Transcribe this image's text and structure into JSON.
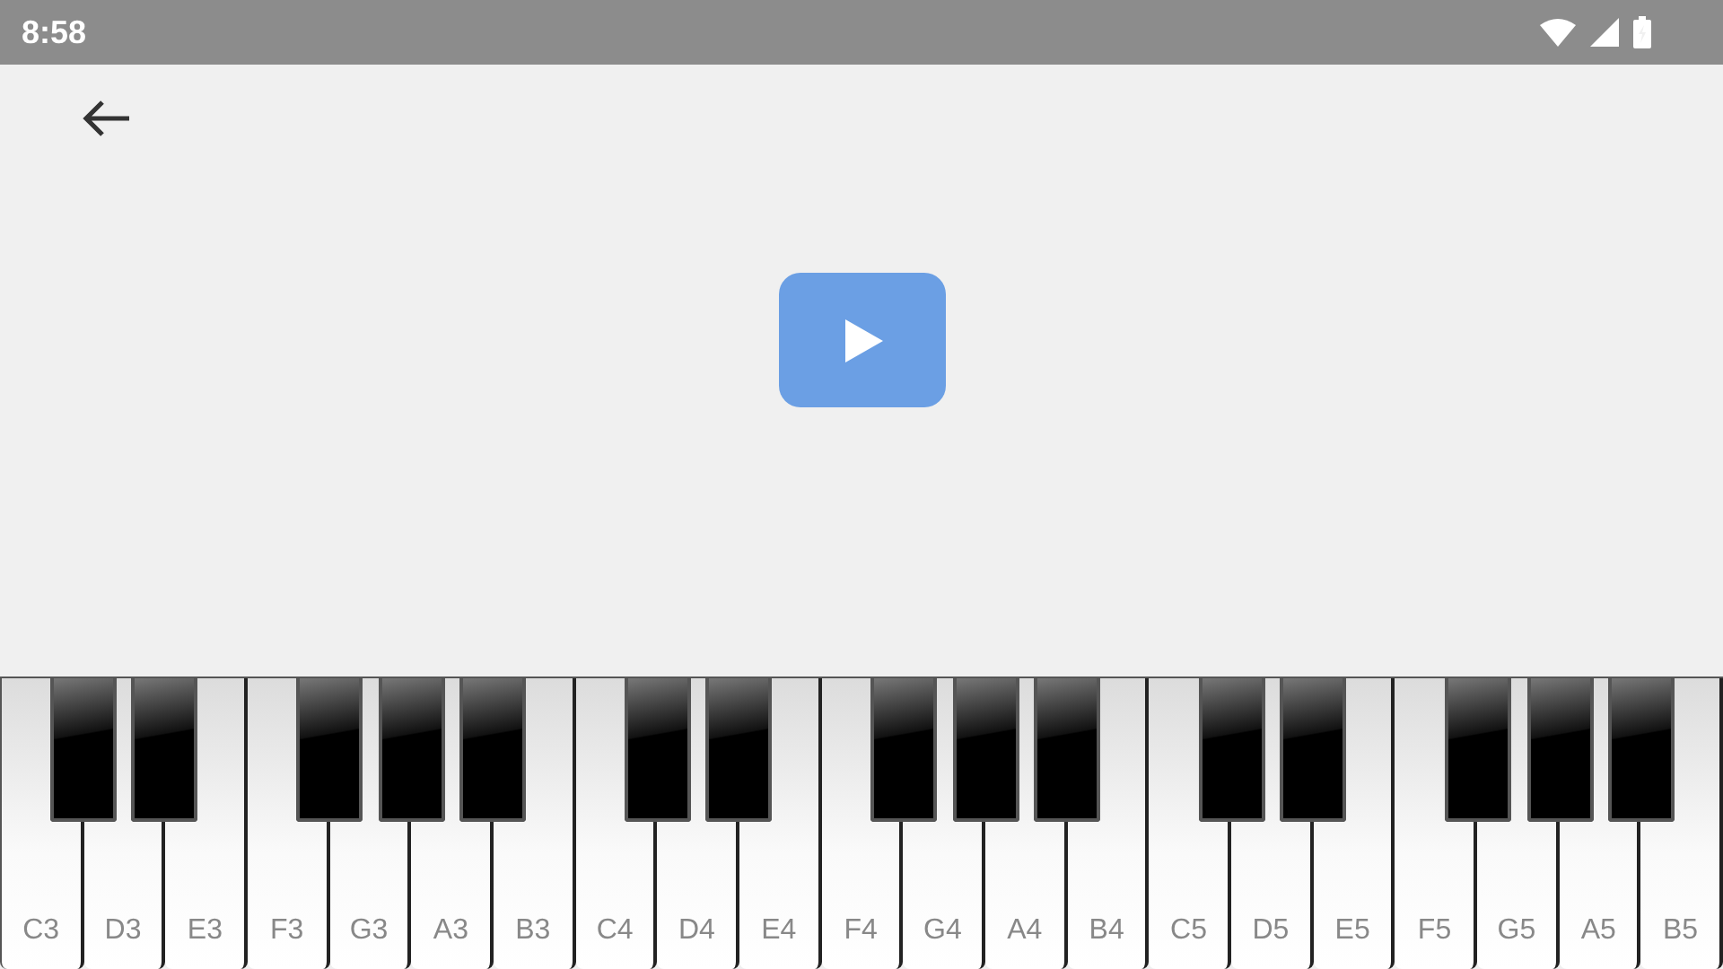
{
  "status_bar": {
    "time": "8:58"
  },
  "keys": [
    {
      "label": "C3",
      "sharp": true
    },
    {
      "label": "D3",
      "sharp": true
    },
    {
      "label": "E3",
      "sharp": false
    },
    {
      "label": "F3",
      "sharp": true
    },
    {
      "label": "G3",
      "sharp": true
    },
    {
      "label": "A3",
      "sharp": true
    },
    {
      "label": "B3",
      "sharp": false
    },
    {
      "label": "C4",
      "sharp": true
    },
    {
      "label": "D4",
      "sharp": true
    },
    {
      "label": "E4",
      "sharp": false
    },
    {
      "label": "F4",
      "sharp": true
    },
    {
      "label": "G4",
      "sharp": true
    },
    {
      "label": "A4",
      "sharp": true
    },
    {
      "label": "B4",
      "sharp": false
    },
    {
      "label": "C5",
      "sharp": true
    },
    {
      "label": "D5",
      "sharp": true
    },
    {
      "label": "E5",
      "sharp": false
    },
    {
      "label": "F5",
      "sharp": true
    },
    {
      "label": "G5",
      "sharp": true
    },
    {
      "label": "A5",
      "sharp": true
    },
    {
      "label": "B5",
      "sharp": false
    }
  ]
}
